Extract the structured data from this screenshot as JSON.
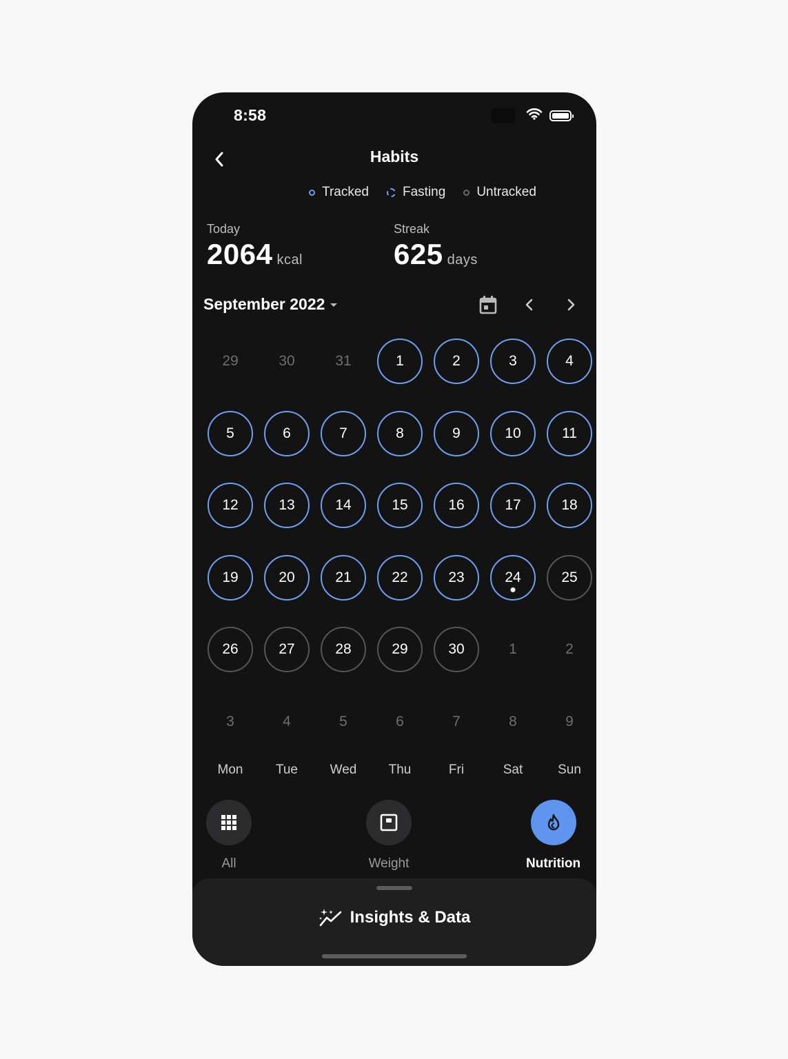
{
  "status_bar": {
    "time": "8:58"
  },
  "header": {
    "title": "Habits"
  },
  "legend": [
    {
      "key": "tracked",
      "label": "Tracked"
    },
    {
      "key": "fasting",
      "label": "Fasting"
    },
    {
      "key": "untracked",
      "label": "Untracked"
    }
  ],
  "stats": {
    "today": {
      "label": "Today",
      "value": "2064",
      "unit": "kcal"
    },
    "streak": {
      "label": "Streak",
      "value": "625",
      "unit": "days"
    }
  },
  "calendar": {
    "month": "September 2022",
    "days": [
      {
        "n": "29",
        "s": "muted"
      },
      {
        "n": "30",
        "s": "muted"
      },
      {
        "n": "31",
        "s": "muted"
      },
      {
        "n": "1",
        "s": "tracked"
      },
      {
        "n": "2",
        "s": "tracked"
      },
      {
        "n": "3",
        "s": "tracked"
      },
      {
        "n": "4",
        "s": "tracked"
      },
      {
        "n": "5",
        "s": "tracked"
      },
      {
        "n": "6",
        "s": "tracked"
      },
      {
        "n": "7",
        "s": "tracked"
      },
      {
        "n": "8",
        "s": "tracked"
      },
      {
        "n": "9",
        "s": "tracked"
      },
      {
        "n": "10",
        "s": "tracked"
      },
      {
        "n": "11",
        "s": "tracked"
      },
      {
        "n": "12",
        "s": "tracked"
      },
      {
        "n": "13",
        "s": "tracked"
      },
      {
        "n": "14",
        "s": "tracked"
      },
      {
        "n": "15",
        "s": "tracked"
      },
      {
        "n": "16",
        "s": "tracked"
      },
      {
        "n": "17",
        "s": "tracked"
      },
      {
        "n": "18",
        "s": "tracked"
      },
      {
        "n": "19",
        "s": "tracked"
      },
      {
        "n": "20",
        "s": "tracked"
      },
      {
        "n": "21",
        "s": "tracked"
      },
      {
        "n": "22",
        "s": "tracked"
      },
      {
        "n": "23",
        "s": "tracked"
      },
      {
        "n": "24",
        "s": "tracked",
        "today": true
      },
      {
        "n": "25",
        "s": "untracked"
      },
      {
        "n": "26",
        "s": "untracked"
      },
      {
        "n": "27",
        "s": "untracked"
      },
      {
        "n": "28",
        "s": "untracked"
      },
      {
        "n": "29",
        "s": "untracked"
      },
      {
        "n": "30",
        "s": "untracked"
      },
      {
        "n": "1",
        "s": "muted"
      },
      {
        "n": "2",
        "s": "muted"
      },
      {
        "n": "3",
        "s": "muted"
      },
      {
        "n": "4",
        "s": "muted"
      },
      {
        "n": "5",
        "s": "muted"
      },
      {
        "n": "6",
        "s": "muted"
      },
      {
        "n": "7",
        "s": "muted"
      },
      {
        "n": "8",
        "s": "muted"
      },
      {
        "n": "9",
        "s": "muted"
      }
    ],
    "weekdays": [
      "Mon",
      "Tue",
      "Wed",
      "Thu",
      "Fri",
      "Sat",
      "Sun"
    ]
  },
  "tabs": [
    {
      "label": "All",
      "icon": "grid-icon",
      "active": false
    },
    {
      "label": "Weight",
      "icon": "scale-icon",
      "active": false
    },
    {
      "label": "Nutrition",
      "icon": "flame-icon",
      "active": true
    }
  ],
  "sheet": {
    "title": "Insights & Data"
  },
  "colors": {
    "accent": "#5f95ee",
    "tracked_ring": "#6f9ff0",
    "untracked_ring": "#555555",
    "background": "#131314"
  }
}
